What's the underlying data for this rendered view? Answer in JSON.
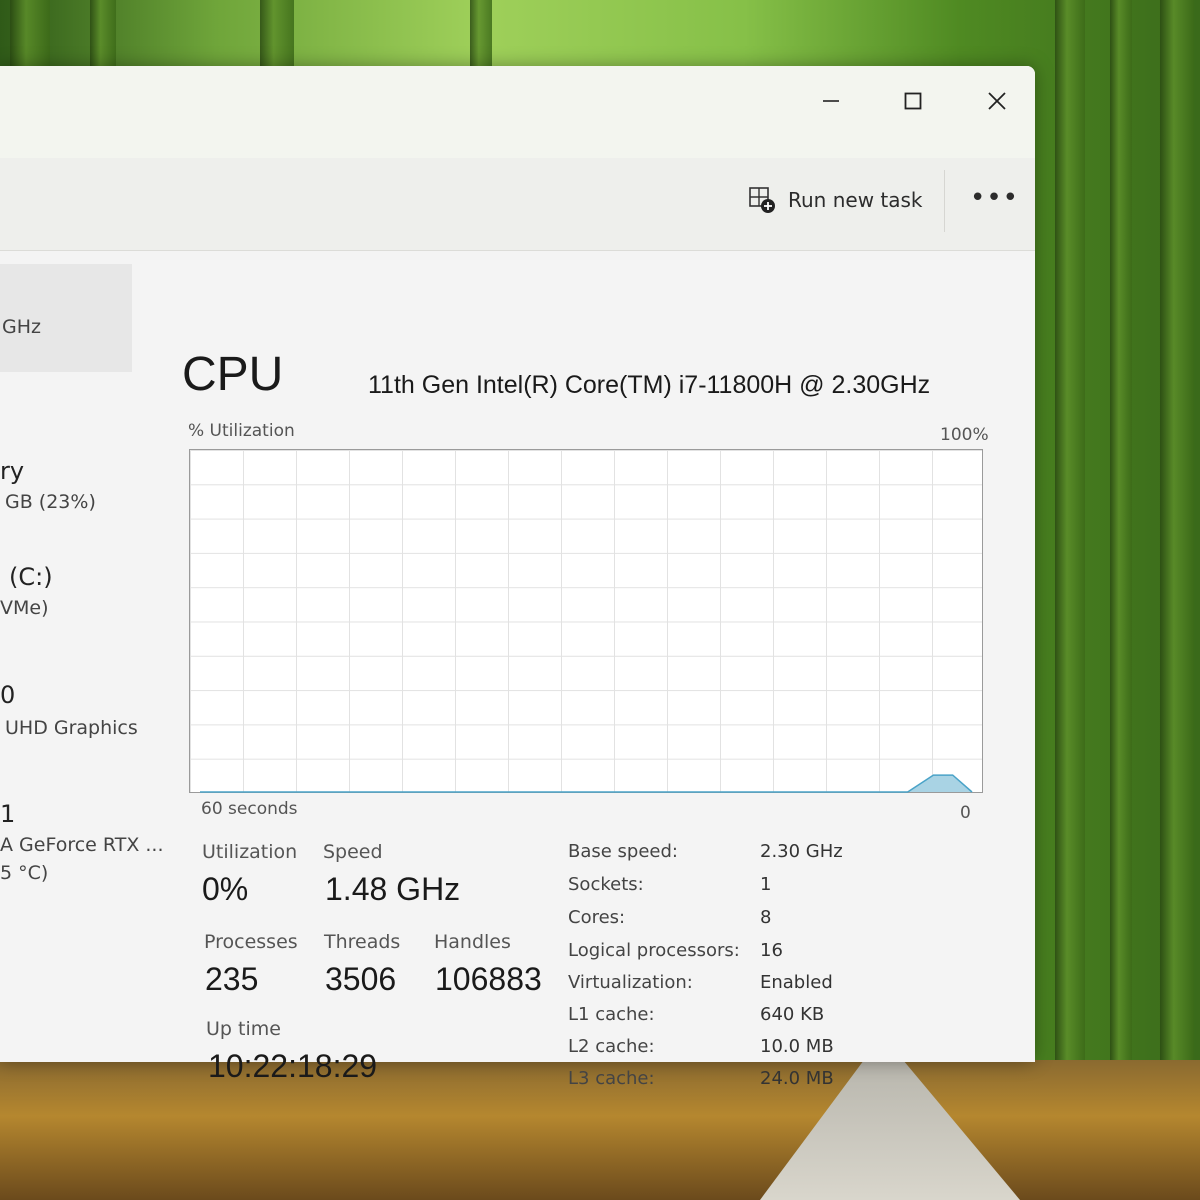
{
  "window": {
    "minimize_label": "Minimize",
    "maximize_label": "Maximize",
    "close_label": "Close"
  },
  "toolbar": {
    "run_new_task": "Run new task",
    "more": "•••"
  },
  "sidebar": {
    "items": [
      {
        "title": "",
        "sub": "GHz"
      },
      {
        "title": "ry",
        "sub": "GB (23%)"
      },
      {
        "title": "(C:)",
        "sub": "VMe)"
      },
      {
        "title": "0",
        "sub": "UHD Graphics"
      },
      {
        "title": "1",
        "sub": "A GeForce RTX ...",
        "sub2": "5 °C)"
      }
    ]
  },
  "cpu": {
    "title": "CPU",
    "model": "11th Gen Intel(R) Core(TM) i7-11800H @ 2.30GHz",
    "util_axis_label": "% Utilization",
    "max_label": "100%",
    "time_label": "60 seconds",
    "min_label": "0"
  },
  "chart_data": {
    "type": "area",
    "title": "",
    "xlabel": "60 seconds",
    "ylabel": "% Utilization",
    "ylim": [
      0,
      100
    ],
    "x": [
      60,
      5,
      3,
      1.5,
      0
    ],
    "values": [
      0,
      0,
      5,
      5,
      0
    ],
    "grid": true
  },
  "stats": {
    "utilization_label": "Utilization",
    "utilization_value": "0%",
    "speed_label": "Speed",
    "speed_value": "1.48 GHz",
    "processes_label": "Processes",
    "processes_value": "235",
    "threads_label": "Threads",
    "threads_value": "3506",
    "handles_label": "Handles",
    "handles_value": "106883",
    "uptime_label": "Up time",
    "uptime_value": "10:22:18:29"
  },
  "info": [
    {
      "label": "Base speed:",
      "value": "2.30 GHz"
    },
    {
      "label": "Sockets:",
      "value": "1"
    },
    {
      "label": "Cores:",
      "value": "8"
    },
    {
      "label": "Logical processors:",
      "value": "16"
    },
    {
      "label": "Virtualization:",
      "value": "Enabled"
    },
    {
      "label": "L1 cache:",
      "value": "640 KB"
    },
    {
      "label": "L2 cache:",
      "value": "10.0 MB"
    },
    {
      "label": "L3 cache:",
      "value": "24.0 MB"
    }
  ],
  "colors": {
    "graph_fill": "#a9d3e4",
    "graph_line": "#4aa3c8"
  }
}
